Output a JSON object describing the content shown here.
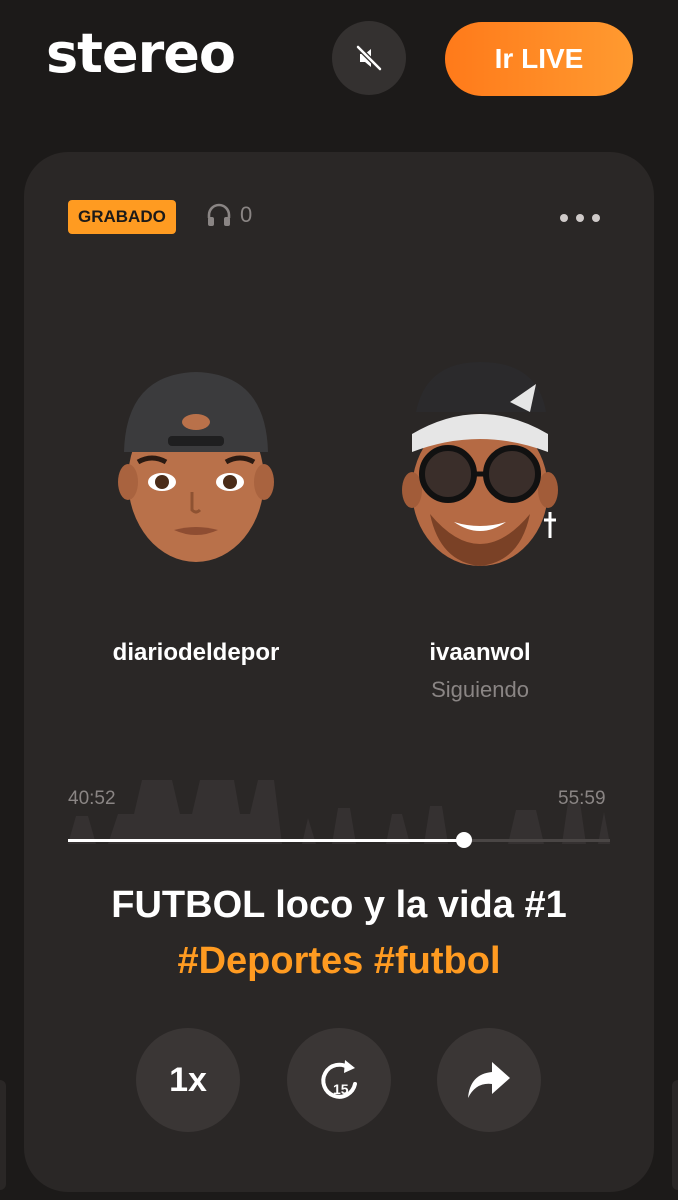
{
  "header": {
    "logo": "stereo",
    "mute_icon": "muted-speaker-icon",
    "live_button": "Ir LIVE",
    "accent": "#ff8a25"
  },
  "card": {
    "badge": "GRABADO",
    "listeners_icon": "headphones-icon",
    "listeners_count": "0",
    "more_icon": "more-dots-icon",
    "speakers": [
      {
        "name": "diariodeldepor",
        "status": ""
      },
      {
        "name": "ivaanwol",
        "status": "Siguiendo"
      }
    ],
    "player": {
      "elapsed": "40:52",
      "total": "55:59",
      "progress": 0.73
    },
    "title": "FUTBOL loco y la vida #1",
    "tags": "#Deportes #futbol",
    "controls": {
      "speed": "1x",
      "rewind_label": "15",
      "rewind_icon": "rewind-15-icon",
      "share_icon": "share-arrow-icon"
    }
  }
}
